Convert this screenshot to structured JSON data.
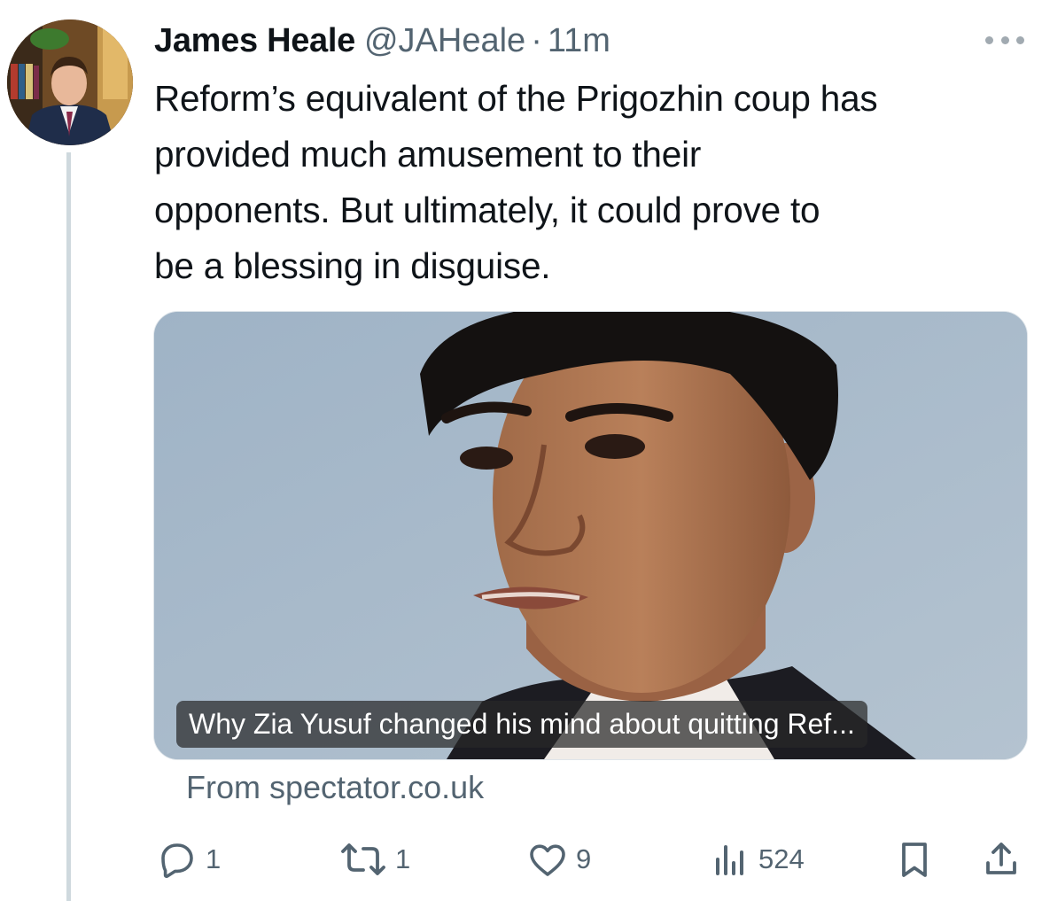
{
  "tweet": {
    "author": {
      "display_name": "James Heale",
      "handle": "@JAHeale",
      "avatar_icon": "profile-photo"
    },
    "separator": "·",
    "timestamp": "11m",
    "text": "Reform’s equivalent of the Prigozhin coup has\nprovided much amusement to their\nopponents. But ultimately, it could prove to\nbe a blessing in disguise.",
    "card": {
      "image_icon": "portrait-photo",
      "caption": "Why Zia Yusuf changed his mind about quitting Ref...",
      "source": "From spectator.co.uk"
    },
    "actions": {
      "reply_count": "1",
      "retweet_count": "1",
      "like_count": "9",
      "view_count": "524"
    }
  },
  "colors": {
    "text": "#0f1419",
    "secondary_text": "#536471",
    "thread_line": "#cfd9de"
  }
}
